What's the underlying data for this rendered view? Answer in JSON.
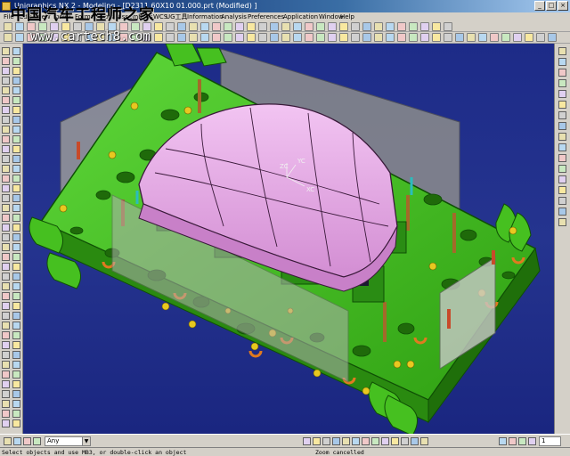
{
  "window": {
    "title": "Unigraphics NX 2 - Modeling - [D2311 60X10 01.000.prt (Modified) ]",
    "minimize": "_",
    "maximize": "□",
    "close": "×"
  },
  "watermark": {
    "line1": "中国汽车工程师之家",
    "line2": "www.cartech8.com"
  },
  "menu": [
    "File",
    "Edit",
    "View",
    "Insert",
    "Format",
    "Tools",
    "Assemblies",
    "WCS",
    "UG工具",
    "Information",
    "Analysis",
    "Preferences",
    "Application",
    "Window",
    "Help"
  ],
  "viewport": {
    "wcs_y": "YC",
    "wcs_x": "XC",
    "wcs_z": "ZC",
    "colors": {
      "background": "#1f2d8a",
      "fixture_green": "#3fbf1a",
      "fixture_dark": "#1f6f0a",
      "part_pink": "#e6a6e6",
      "panel_gray": "#9a9a9a"
    }
  },
  "bottom": {
    "selection_filter": "Any",
    "layer_value": "1"
  },
  "status": {
    "prompt": "Select objects and use MB3, or double-click an object",
    "message": "Zoom cancelled"
  }
}
